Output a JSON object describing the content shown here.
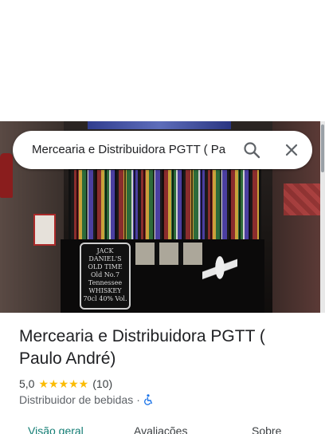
{
  "search": {
    "query": "Mercearia e Distribuidora PGTT ( Pa"
  },
  "place": {
    "name": "Mercearia e Distribuidora PGTT ( Paulo André)",
    "rating": "5,0",
    "stars": "★★★★★",
    "review_count": "(10)",
    "category": "Distribuidor de bebidas",
    "separator": "·",
    "accessibility_icon": "wheelchair-icon"
  },
  "photo": {
    "label_lines": [
      "JACK DANIEL'S",
      "OLD TIME",
      "Old No.7",
      "Tennessee",
      "WHISKEY",
      "70cl  40% Vol."
    ]
  },
  "tabs": [
    {
      "label": "Visão geral",
      "active": true
    },
    {
      "label": "Avaliações",
      "active": false
    },
    {
      "label": "Sobre",
      "active": false
    }
  ],
  "colors": {
    "accent": "#137d74",
    "star": "#fbbc04",
    "accessible": "#1a73e8"
  }
}
